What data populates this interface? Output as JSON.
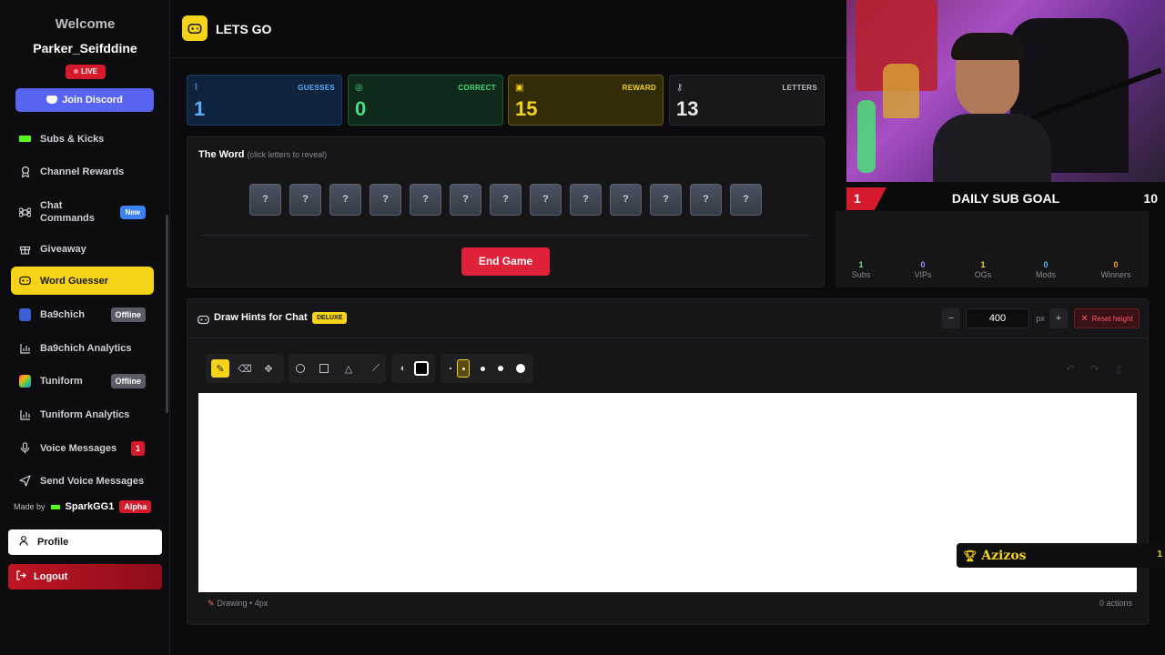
{
  "sidebar": {
    "welcome": "Welcome",
    "username": "Parker_Seifddine",
    "live_label": "LIVE",
    "discord_label": "Join Discord",
    "items": [
      {
        "label": "Subs & Kicks",
        "icon": "kick-icon"
      },
      {
        "label": "Channel Rewards",
        "icon": "award-icon"
      },
      {
        "label": "Chat Commands",
        "icon": "command-icon",
        "badge": "New"
      },
      {
        "label": "Giveaway",
        "icon": "gift-icon"
      },
      {
        "label": "Word Guesser",
        "icon": "gamepad-icon",
        "active": true
      },
      {
        "label": "Ba9chich",
        "icon": "ba9chich-logo-icon",
        "badge": "Offline"
      },
      {
        "label": "Ba9chich Analytics",
        "icon": "bar-chart-icon"
      },
      {
        "label": "Tuniform",
        "icon": "tuniform-logo-icon",
        "badge": "Offline"
      },
      {
        "label": "Tuniform Analytics",
        "icon": "bar-chart-icon"
      },
      {
        "label": "Voice Messages",
        "icon": "microphone-icon",
        "badge": "1"
      },
      {
        "label": "Send Voice Messages",
        "icon": "send-icon"
      }
    ],
    "made_by_label": "Made by",
    "made_by_name": "SparkGG1",
    "made_by_badge": "Alpha",
    "profile_label": "Profile",
    "logout_label": "Logout"
  },
  "header": {
    "title": "LETS GO"
  },
  "stats": [
    {
      "label": "GUESSES",
      "value": "1",
      "color": "#1a4a8a"
    },
    {
      "label": "CORRECT",
      "value": "0",
      "color": "#1e6a3a"
    },
    {
      "label": "REWARD",
      "value": "15",
      "color": "#8a7a14"
    },
    {
      "label": "LETTERS",
      "value": "13",
      "color": "#2a2a2e"
    }
  ],
  "word_panel": {
    "title": "The Word",
    "hint": "(click letters to reveal)",
    "tiles": [
      "?",
      "?",
      "?",
      "?",
      "?",
      "?",
      "?",
      "?",
      "?",
      "?",
      "?",
      "?",
      "?"
    ],
    "end_button": "End Game"
  },
  "draw_panel": {
    "title": "Draw Hints for Chat",
    "badge": "DELUXE",
    "height_value": "400",
    "height_unit": "px",
    "reset_label": "Reset height",
    "status_left": "Drawing • 4px",
    "status_right": "0 actions"
  },
  "overlay": {
    "goal_current": "1",
    "goal_title": "DAILY SUB GOAL",
    "goal_target": "10",
    "mini_stats": [
      {
        "value": "1",
        "label": "Subs",
        "color": "#7ae08a"
      },
      {
        "value": "0",
        "label": "VIPs",
        "color": "#b084ff"
      },
      {
        "value": "1",
        "label": "OGs",
        "color": "#f5d318"
      },
      {
        "value": "0",
        "label": "Mods",
        "color": "#5ab0ff"
      },
      {
        "value": "0",
        "label": "Winners",
        "color": "#f5a518"
      }
    ],
    "winner_name": "Azizos",
    "winner_count": "1"
  }
}
